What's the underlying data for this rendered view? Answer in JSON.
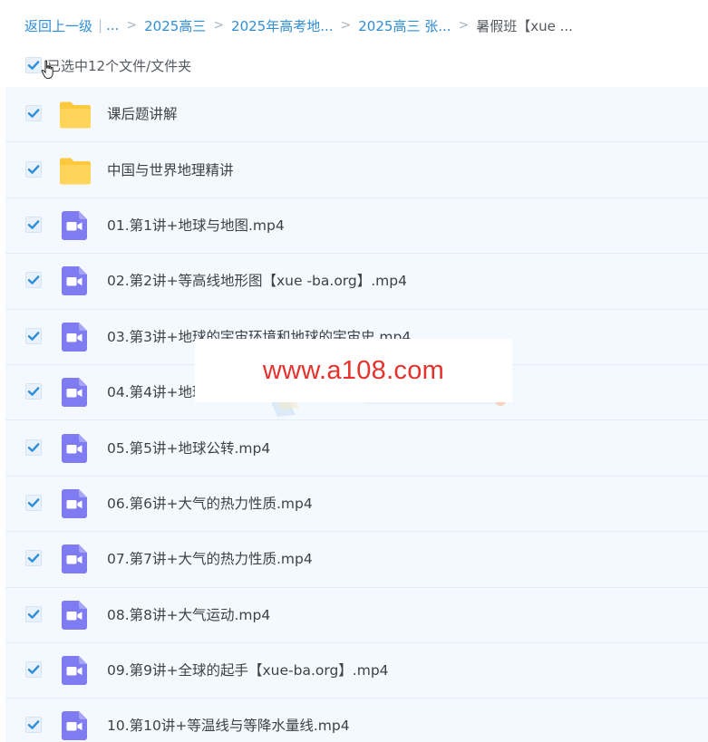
{
  "breadcrumb": {
    "back_label": "返回上一级",
    "ellipsis": "...",
    "items": [
      {
        "label": "2025高三"
      },
      {
        "label": "2025年高考地..."
      },
      {
        "label": "2025高三 张..."
      }
    ],
    "current": "暑假班【xue ..."
  },
  "selection": {
    "status_text": "已选中12个文件/文件夹"
  },
  "files": [
    {
      "name": "课后题讲解",
      "type": "folder"
    },
    {
      "name": "中国与世界地理精讲",
      "type": "folder"
    },
    {
      "name": "01.第1讲+地球与地图.mp4",
      "type": "video"
    },
    {
      "name": "02.第2讲+等高线地形图【xue -ba.org】.mp4",
      "type": "video"
    },
    {
      "name": "03.第3讲+地球的宇宙环境和地球的宇宙史.mp4",
      "type": "video"
    },
    {
      "name": "04.第4讲+地球",
      "type": "video"
    },
    {
      "name": "05.第5讲+地球公转.mp4",
      "type": "video"
    },
    {
      "name": "06.第6讲+大气的热力性质.mp4",
      "type": "video"
    },
    {
      "name": "07.第7讲+大气的热力性质.mp4",
      "type": "video"
    },
    {
      "name": "08.第8讲+大气运动.mp4",
      "type": "video"
    },
    {
      "name": "09.第9讲+全球的起手【xue-ba.org】.mp4",
      "type": "video"
    },
    {
      "name": "10.第10讲+等温线与等降水量线.mp4",
      "type": "video"
    }
  ],
  "watermark": {
    "text": "www.a108.com"
  },
  "colors": {
    "link": "#2e8ed8",
    "checkbox_check": "#2e8ed8",
    "folder": "#fcc83e",
    "video": "#7e7cf0",
    "row_bg": "#f3f9fe",
    "watermark": "#e5322d"
  },
  "icons": {
    "checkbox": "check-icon",
    "folder": "folder-icon",
    "video": "video-file-icon",
    "cursor": "hand-pointer-icon"
  }
}
